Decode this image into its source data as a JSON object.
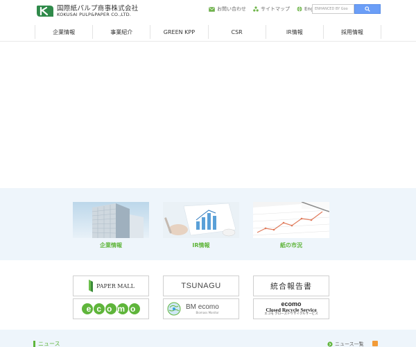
{
  "header": {
    "logo_ja": "国際紙パルプ商事株式会社",
    "logo_en": "KOKUSAI PULP&PAPER CO.,LTD.",
    "utility": [
      {
        "label": "お問い合わせ",
        "icon": "mail-icon"
      },
      {
        "label": "サイトマップ",
        "icon": "sitemap-icon"
      },
      {
        "label": "English",
        "icon": "globe-icon"
      }
    ],
    "search": {
      "placeholder": "ENHANCED BY Goo"
    }
  },
  "nav": [
    "企業情報",
    "事業紹介",
    "GREEN KPP",
    "CSR",
    "IR情報",
    "採用情報"
  ],
  "features": [
    {
      "label": "企業情報",
      "image": "office-building-photo"
    },
    {
      "label": "IR情報",
      "image": "chart-report-photo"
    },
    {
      "label": "紙の市況",
      "image": "line-graph-photo"
    }
  ],
  "banners": {
    "paper_mall": "PAPER MALL",
    "tsunagu": "TSUNAGU",
    "report": "統合報告書",
    "ecomo": "ecomo",
    "bm_ecomo": "BM ecomo",
    "bm_sub": "Biomass Monitor",
    "closed_title": "ecomo",
    "closed_sub": "Closed Recycle Service",
    "closed_ja": "エコモ クローズドリサイクルサービス"
  },
  "news": {
    "title": "ニュース",
    "list_link": "ニュース一覧"
  },
  "colors": {
    "accent_green": "#5fb53b",
    "band_blue": "#eef5fb",
    "search_blue": "#6b9ef7"
  }
}
